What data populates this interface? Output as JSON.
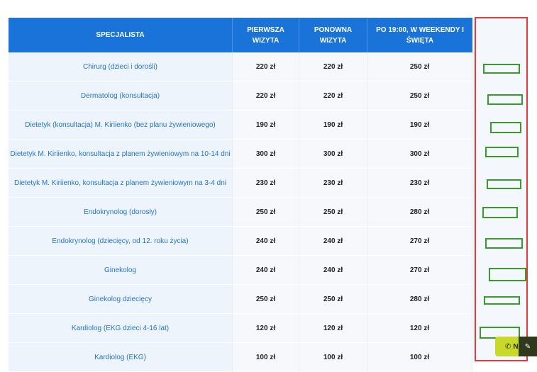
{
  "table": {
    "headers": [
      "SPECJALISTA",
      "PIERWSZA WIZYTA",
      "PONOWNA WIZYTA",
      "PO 19:00, W WEEKENDY I ŚWIĘTA"
    ],
    "rows": [
      {
        "name": "Chirurg (dzieci i dorośli)",
        "first": "220 zł",
        "repeat": "220 zł",
        "after": "250 zł"
      },
      {
        "name": "Dermatolog (konsultacja)",
        "first": "220 zł",
        "repeat": "220 zł",
        "after": "250 zł"
      },
      {
        "name": "Dietetyk (konsultacja) M. Kiriienko (bez planu żywieniowego)",
        "first": "190 zł",
        "repeat": "190 zł",
        "after": "190 zł"
      },
      {
        "name": "Dietetyk M. Kiriienko, konsultacja z planem żywieniowym na 10-14 dni",
        "first": "300 zł",
        "repeat": "300 zł",
        "after": "300 zł"
      },
      {
        "name": "Dietetyk M. Kiriienko, konsultacja z planem żywieniowym na 3-4 dni",
        "first": "230 zł",
        "repeat": "230 zł",
        "after": "230 zł"
      },
      {
        "name": "Endokrynolog (dorosły)",
        "first": "250 zł",
        "repeat": "250 zł",
        "after": "280 zł"
      },
      {
        "name": "Endokrynolog (dziecięcy, od 12. roku życia)",
        "first": "240 zł",
        "repeat": "240 zł",
        "after": "270 zł"
      },
      {
        "name": "Ginekolog",
        "first": "240 zł",
        "repeat": "240 zł",
        "after": "270 zł"
      },
      {
        "name": "Ginekolog dziecięcy",
        "first": "250 zł",
        "repeat": "250 zł",
        "after": "280 zł"
      },
      {
        "name": "Kardiolog (EKG dzieci 4-16 lat)",
        "first": "120 zł",
        "repeat": "120 zł",
        "after": "120 zł"
      },
      {
        "name": "Kardiolog (EKG)",
        "first": "100 zł",
        "repeat": "100 zł",
        "after": "100 zł"
      }
    ]
  },
  "floating": {
    "call_label": "N",
    "phone_icon": "phone-icon",
    "chat_icon": "chat-icon"
  },
  "colors": {
    "header_bg": "#1a73d9",
    "name_text": "#2474c9",
    "annotation_red": "#e23b3b",
    "annotation_green": "#3a9a2c",
    "call_button": "#c9d92a"
  }
}
